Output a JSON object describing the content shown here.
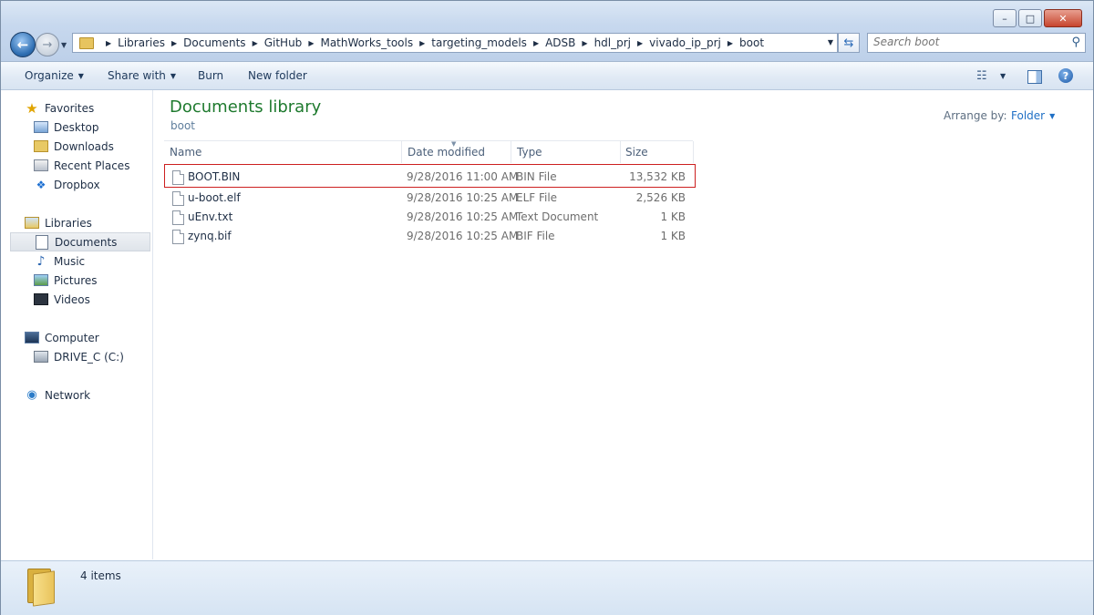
{
  "window": {
    "controls": {
      "minimize": "–",
      "maximize": "□",
      "close": "✕"
    }
  },
  "nav": {
    "back_icon": "back-arrow-icon",
    "forward_icon": "forward-arrow-icon"
  },
  "address": {
    "crumbs": [
      "Libraries",
      "Documents",
      "GitHub",
      "MathWorks_tools",
      "targeting_models",
      "ADSB",
      "hdl_prj",
      "vivado_ip_prj",
      "boot"
    ]
  },
  "search": {
    "placeholder": "Search boot"
  },
  "toolbar": {
    "organize": "Organize",
    "share_with": "Share with",
    "burn": "Burn",
    "new_folder": "New folder"
  },
  "sidebar": {
    "favorites": {
      "label": "Favorites",
      "items": [
        "Desktop",
        "Downloads",
        "Recent Places",
        "Dropbox"
      ]
    },
    "libraries": {
      "label": "Libraries",
      "items": [
        "Documents",
        "Music",
        "Pictures",
        "Videos"
      ]
    },
    "computer": {
      "label": "Computer",
      "items": [
        "DRIVE_C (C:)"
      ]
    },
    "network": {
      "label": "Network"
    }
  },
  "library": {
    "title": "Documents library",
    "subtitle": "boot",
    "arrange_label": "Arrange by:",
    "arrange_value": "Folder"
  },
  "columns": {
    "name": "Name",
    "date": "Date modified",
    "type": "Type",
    "size": "Size"
  },
  "files": [
    {
      "name": "BOOT.BIN",
      "date": "9/28/2016 11:00 AM",
      "type": "BIN File",
      "size": "13,532 KB"
    },
    {
      "name": "u-boot.elf",
      "date": "9/28/2016 10:25 AM",
      "type": "ELF File",
      "size": "2,526 KB"
    },
    {
      "name": "uEnv.txt",
      "date": "9/28/2016 10:25 AM",
      "type": "Text Document",
      "size": "1 KB"
    },
    {
      "name": "zynq.bif",
      "date": "9/28/2016 10:25 AM",
      "type": "BIF File",
      "size": "1 KB"
    }
  ],
  "status": {
    "items_count": "4 items"
  },
  "colors": {
    "highlight": "#cc1f1f",
    "library_title": "#1e7a2e",
    "link": "#1f6fc5"
  }
}
